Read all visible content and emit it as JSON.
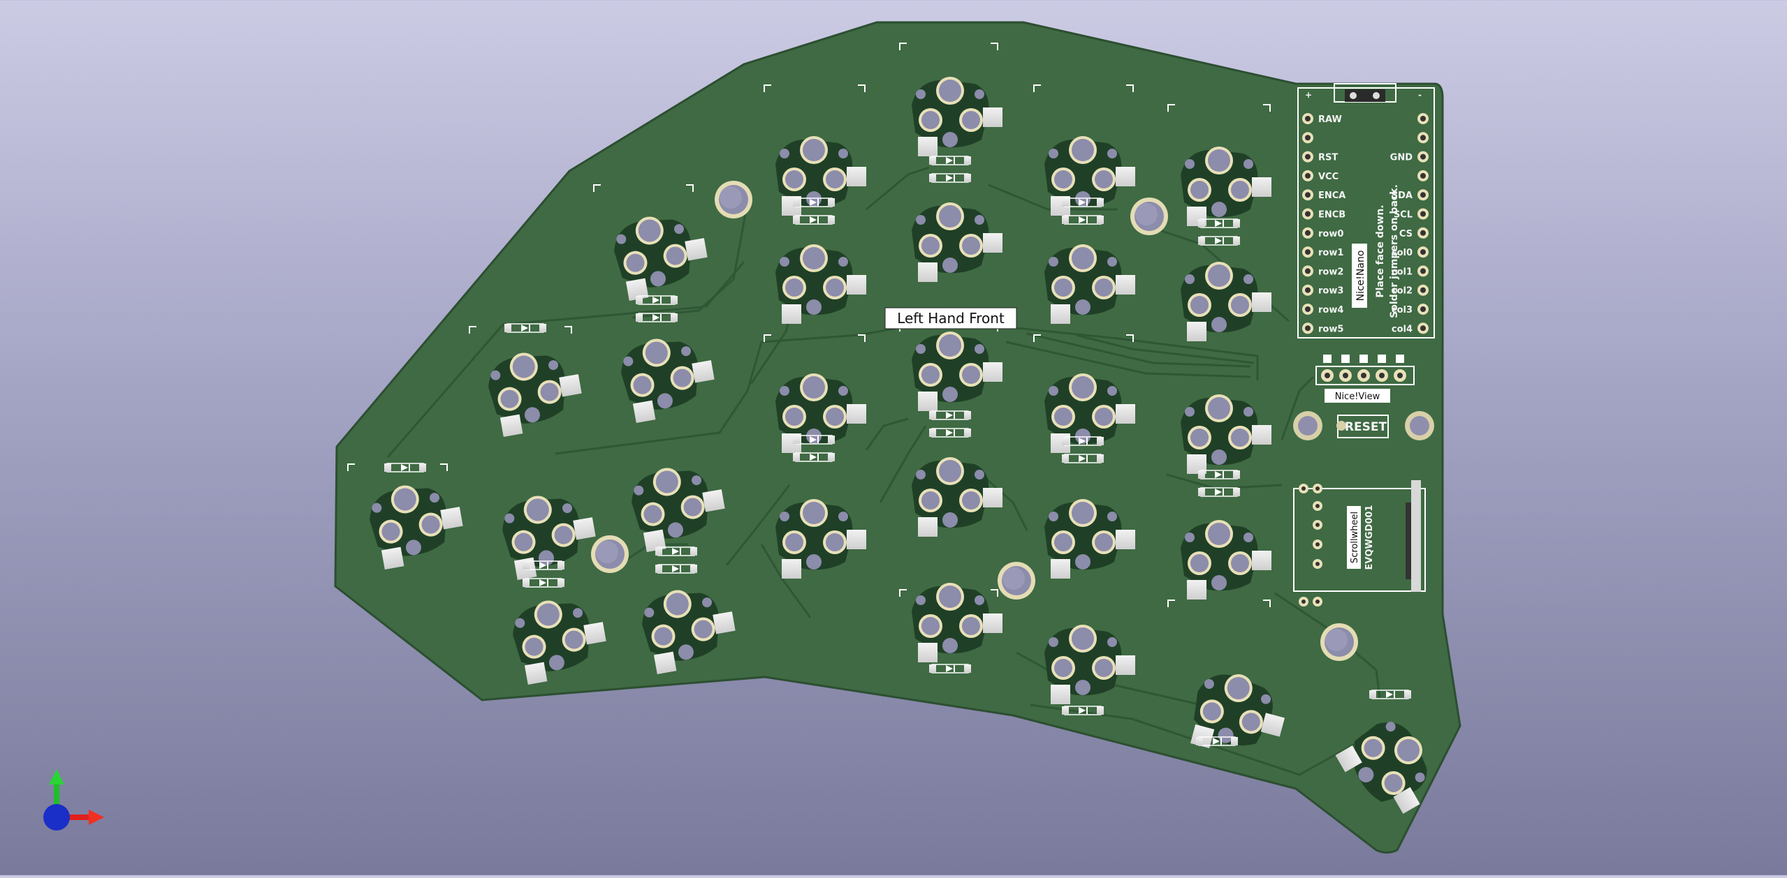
{
  "viewer": {
    "background_top": "#cccbe4",
    "background_bottom": "#7a7a9c",
    "axes_widget": {
      "x_color": "#e0201c",
      "y_color": "#1fbf2a",
      "z_color": "#1a2ec8"
    }
  },
  "board": {
    "color": "#3f6a43",
    "title_label": "Left Hand Front",
    "controller": {
      "name": "Nice!Nano",
      "note_line1": "Place face down.",
      "note_line2": "Solder jumpers on back.",
      "left_pins": [
        "RAW",
        "",
        "RST",
        "VCC",
        "ENCA",
        "ENCB",
        "row0",
        "row1",
        "row2",
        "row3",
        "row4",
        "row5"
      ],
      "right_pins": [
        "",
        "",
        "GND",
        "",
        "SDA",
        "SCL",
        "CS",
        "col0",
        "col1",
        "col2",
        "col3",
        "col4"
      ],
      "top_marks": [
        "+",
        "-"
      ]
    },
    "display_connector": "Nice!View",
    "reset_label": "RESET",
    "scrollwheel": {
      "name": "Scrollwheel",
      "part": "EVQWGD001"
    }
  }
}
